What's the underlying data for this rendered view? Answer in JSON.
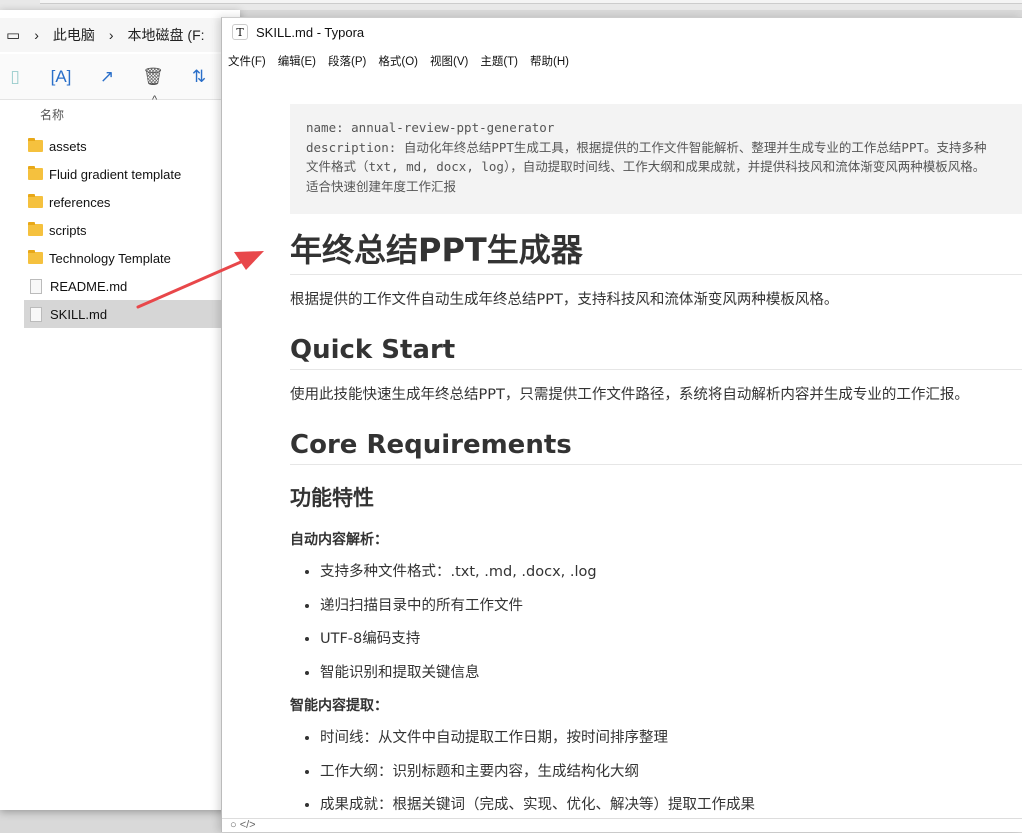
{
  "explorer": {
    "breadcrumb": [
      "此电脑",
      "本地磁盘 (F:"
    ],
    "column_header": "名称",
    "files": [
      {
        "name": "assets",
        "type": "folder"
      },
      {
        "name": "Fluid gradient template",
        "type": "folder"
      },
      {
        "name": "references",
        "type": "folder"
      },
      {
        "name": "scripts",
        "type": "folder"
      },
      {
        "name": "Technology Template",
        "type": "folder"
      },
      {
        "name": "README.md",
        "type": "file"
      },
      {
        "name": "SKILL.md",
        "type": "file",
        "selected": true
      }
    ]
  },
  "typora": {
    "title": "SKILL.md - Typora",
    "logo": "T",
    "menu": [
      "文件(F)",
      "编辑(E)",
      "段落(P)",
      "格式(O)",
      "视图(V)",
      "主题(T)",
      "帮助(H)"
    ],
    "frontmatter": [
      "name: annual-review-ppt-generator",
      "description: 自动化年终总结PPT生成工具，根据提供的工作文件智能解析、整理并生成专业的工作总结PPT。支持多种",
      "文件格式（txt, md, docx, log），自动提取时间线、工作大纲和成果成就，并提供科技风和流体渐变风两种模板风格。",
      "适合快速创建年度工作汇报"
    ],
    "h1": "年终总结PPT生成器",
    "p1": "根据提供的工作文件自动生成年终总结PPT，支持科技风和流体渐变风两种模板风格。",
    "h2_quick": "Quick Start",
    "p2": "使用此技能快速生成年终总结PPT，只需提供工作文件路径，系统将自动解析内容并生成专业的工作汇报。",
    "h2_core": "Core Requirements",
    "h3": "功能特性",
    "section1": {
      "title": "自动内容解析：",
      "items": [
        "支持多种文件格式：.txt, .md, .docx, .log",
        "递归扫描目录中的所有工作文件",
        "UTF-8编码支持",
        "智能识别和提取关键信息"
      ]
    },
    "section2": {
      "title": "智能内容提取：",
      "items": [
        "时间线：从文件中自动提取工作日期，按时间排序整理",
        "工作大纲：识别标题和主要内容，生成结构化大纲",
        "成果成就：根据关键词（完成、实现、优化、解决等）提取工作成果"
      ]
    },
    "status": "○  </>"
  },
  "colors": {
    "arrow": "#e8474a",
    "folder": "#f5c13e",
    "selected": "#d6d6d6"
  }
}
